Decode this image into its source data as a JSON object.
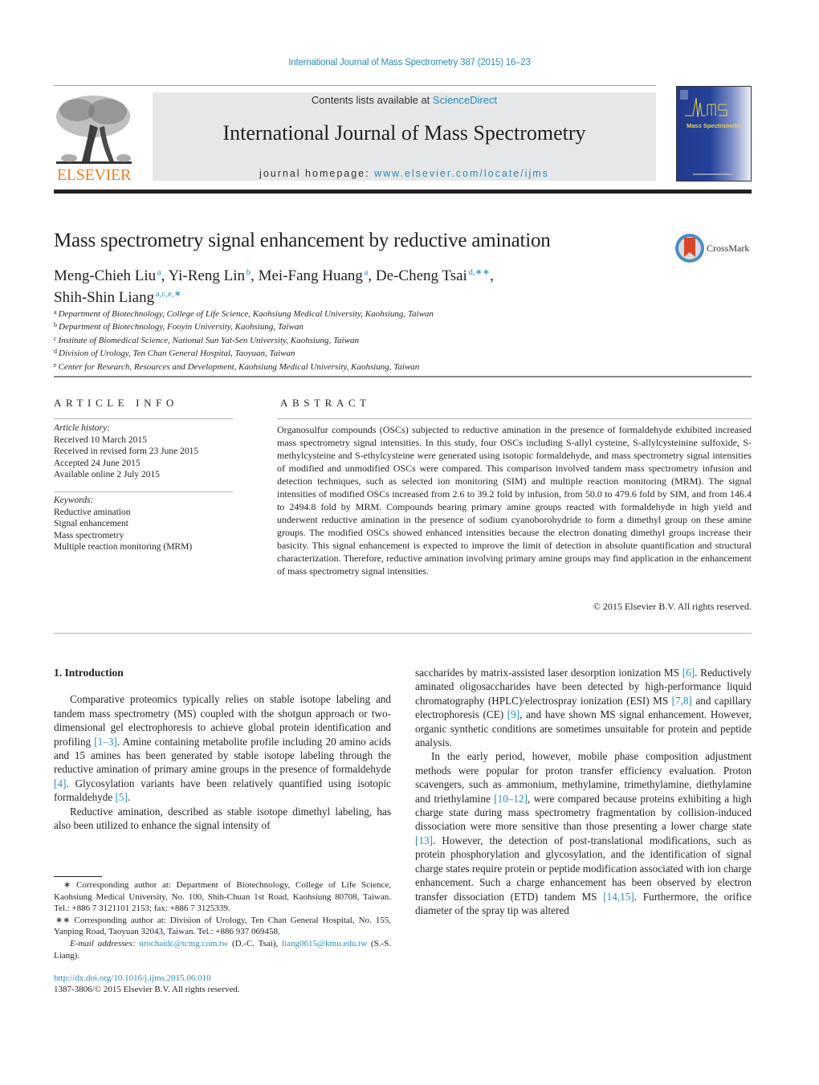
{
  "citation": "International Journal of Mass Spectrometry 387 (2015) 16–23",
  "masthead": {
    "publisher_logo_text": "ELSEVIER",
    "contents_prefix": "Contents lists available at ",
    "contents_link": "ScienceDirect",
    "journal_title": "International Journal of Mass Spectrometry",
    "homepage_prefix": "journal homepage: ",
    "homepage_link": "www.elsevier.com/locate/ijms",
    "cover_title": "Mass Spectrometry",
    "colors": {
      "publisher_orange": "#f47a20",
      "link_blue": "#2a8ab8",
      "masthead_gray": "#e6e7e8",
      "cover_blue": "#233a8c"
    }
  },
  "article": {
    "title": "Mass spectrometry signal enhancement by reductive amination",
    "crossmark_label": "CrossMark",
    "authors": [
      {
        "name": "Meng-Chieh Liu",
        "sup": "a",
        "sep": ", "
      },
      {
        "name": "Yi-Reng Lin",
        "sup": "b",
        "sep": ", "
      },
      {
        "name": "Mei-Fang Huang",
        "sup": "a",
        "sep": ", "
      },
      {
        "name": "De-Cheng Tsai",
        "sup": "d,∗∗",
        "sep": ","
      },
      {
        "name": "Shih-Shin Liang",
        "sup": "a,c,e,∗",
        "sep": ""
      }
    ],
    "affiliations": [
      {
        "key": "a",
        "text": "Department of Biotechnology, College of Life Science, Kaohsiung Medical University, Kaohsiung, Taiwan"
      },
      {
        "key": "b",
        "text": "Department of Biotechnology, Fooyin University, Kaohsiung, Taiwan"
      },
      {
        "key": "c",
        "text": "Institute of Biomedical Science, National Sun Yat-Sen University, Kaohsiung, Taiwan"
      },
      {
        "key": "d",
        "text": "Division of Urology, Ten Chan General Hospital, Taoyuan, Taiwan"
      },
      {
        "key": "e",
        "text": "Center for Research, Resources and Development, Kaohsiung Medical University, Kaohsiung, Taiwan"
      }
    ]
  },
  "article_info": {
    "heading": "ARTICLE INFO",
    "history_label": "Article history:",
    "history": [
      "Received 10 March 2015",
      "Received in revised form 23 June 2015",
      "Accepted 24 June 2015",
      "Available online 2 July 2015"
    ],
    "keywords_label": "Keywords:",
    "keywords": [
      "Reductive amination",
      "Signal enhancement",
      "Mass spectrometry",
      "Multiple reaction monitoring (MRM)"
    ]
  },
  "abstract": {
    "heading": "ABSTRACT",
    "text": "Organosulfur compounds (OSCs) subjected to reductive amination in the presence of formaldehyde exhibited increased mass spectrometry signal intensities. In this study, four OSCs including S-allyl cysteine, S-allylcysteinine sulfoxide, S-methylcysteine and S-ethylcysteine were generated using isotopic formaldehyde, and mass spectrometry signal intensities of modified and unmodified OSCs were compared. This comparison involved tandem mass spectrometry infusion and detection techniques, such as selected ion monitoring (SIM) and multiple reaction monitoring (MRM). The signal intensities of modified OSCs increased from 2.6 to 39.2 fold by infusion, from 50.0 to 479.6 fold by SIM, and from 146.4 to 2494.8 fold by MRM. Compounds bearing primary amine groups reacted with formaldehyde in high yield and underwent reductive amination in the presence of sodium cyanoborohydride to form a dimethyl group on these amine groups. The modified OSCs showed enhanced intensities because the electron donating dimethyl groups increase their basicity. This signal enhancement is expected to improve the limit of detection in absolute quantification and structural characterization. Therefore, reductive amination involving primary amine groups may find application in the enhancement of mass spectrometry signal intensities.",
    "copyright": "© 2015 Elsevier B.V. All rights reserved."
  },
  "body": {
    "section_heading": "1.  Introduction",
    "left_paragraphs": [
      [
        {
          "t": "Comparative proteomics typically relies on stable isotope labeling and tandem mass spectrometry (MS) coupled with the shotgun approach or two-dimensional gel electrophoresis to achieve global protein identification and profiling "
        },
        {
          "ref": "[1–3]"
        },
        {
          "t": ". Amine containing metabolite profile including 20 amino acids and 15 amines has been generated by stable isotope labeling through the reductive amination of primary amine groups in the presence of formaldehyde "
        },
        {
          "ref": "[4]"
        },
        {
          "t": ". Glycosylation variants have been relatively quantified using isotopic formaldehyde "
        },
        {
          "ref": "[5]"
        },
        {
          "t": "."
        }
      ],
      [
        {
          "t": "Reductive amination, described as stable isotope dimethyl labeling, has also been utilized to enhance the signal intensity of"
        }
      ]
    ],
    "right_paragraphs": [
      [
        {
          "t": "saccharides by matrix-assisted laser desorption ionization MS "
        },
        {
          "ref": "[6]"
        },
        {
          "t": ". Reductively aminated oligosaccharides have been detected by high-performance liquid chromatography (HPLC)/electrospray ionization (ESI) MS "
        },
        {
          "ref": "[7,8]"
        },
        {
          "t": " and capillary electrophoresis (CE) "
        },
        {
          "ref": "[9]"
        },
        {
          "t": ", and have shown MS signal enhancement. However, organic synthetic conditions are sometimes unsuitable for protein and peptide analysis."
        }
      ],
      [
        {
          "t": "In the early period, however, mobile phase composition adjustment methods were popular for proton transfer efficiency evaluation. Proton scavengers, such as ammonium, methylamine, trimethylamine, diethylamine and triethylamine "
        },
        {
          "ref": "[10–12]"
        },
        {
          "t": ", were compared because proteins exhibiting a high charge state during mass spectrometry fragmentation by collision-induced dissociation were more sensitive than those presenting a lower charge state "
        },
        {
          "ref": "[13]"
        },
        {
          "t": ". However, the detection of post-translational modifications, such as protein phosphorylation and glycosylation, and the identification of signal charge states require protein or peptide modification associated with ion charge enhancement. Such a charge enhancement has been observed by electron transfer dissociation (ETD) tandem MS "
        },
        {
          "ref": "[14,15]"
        },
        {
          "t": ". Furthermore, the orifice diameter of the spray tip was altered"
        }
      ]
    ]
  },
  "footnotes": {
    "star1": "∗  Corresponding author at: Department of Biotechnology, College of Life Science, Kaohsiung Medical University, No. 100, Shih-Chuan 1st Road, Kaohsiung 80708, Taiwan. Tel.: +886 7 3121101 2153; fax: +886 7 3125339.",
    "star2": "∗∗  Corresponding author at: Division of Urology, Ten Chan General Hospital, No. 155, Yanping Road, Taoyuan 32043, Taiwan. Tel.: +886 937 069458.",
    "email_label": "E-mail addresses: ",
    "email1": "urochaidc@tcmg.com.tw",
    "email1_owner": " (D.-C. Tsai), ",
    "email2": "liang0615@kmu.edu.tw",
    "email2_owner": " (S.-S. Liang)."
  },
  "doi": {
    "link": "http://dx.doi.org/10.1016/j.ijms.2015.06.010",
    "issn_line": "1387-3806/© 2015 Elsevier B.V. All rights reserved."
  }
}
